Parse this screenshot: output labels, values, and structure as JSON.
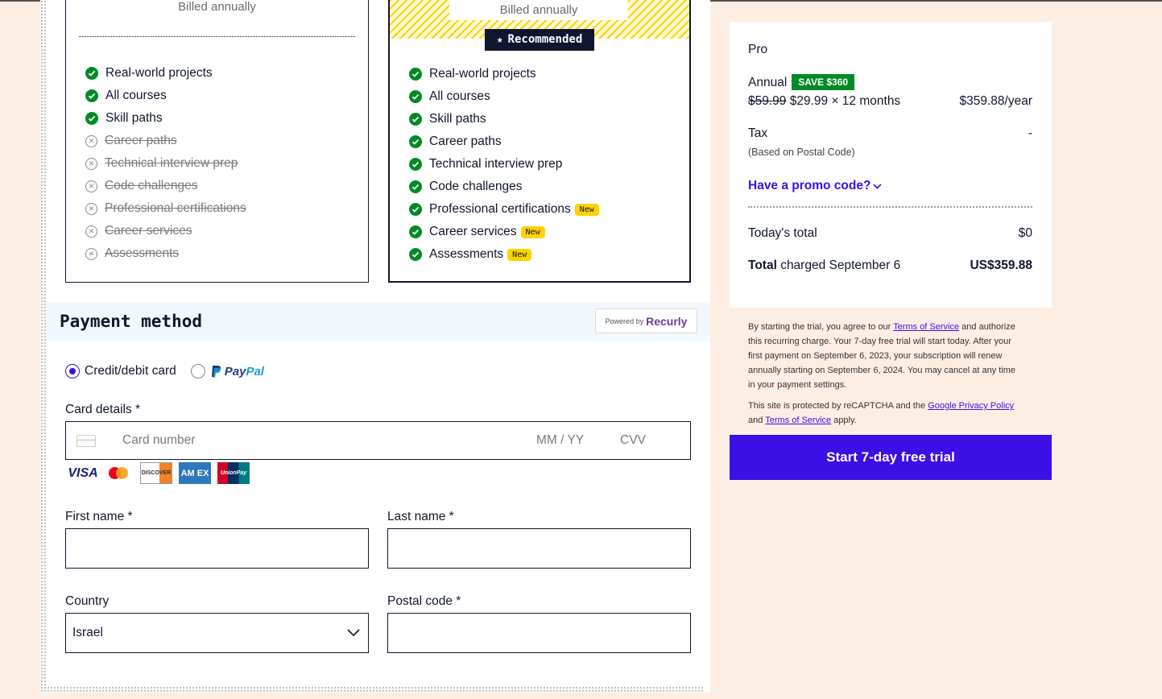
{
  "plans": {
    "basic": {
      "billing": "Billed annually",
      "features": [
        {
          "label": "Real-world projects",
          "included": true
        },
        {
          "label": "All courses",
          "included": true
        },
        {
          "label": "Skill paths",
          "included": true
        },
        {
          "label": "Career paths",
          "included": false
        },
        {
          "label": "Technical interview prep",
          "included": false
        },
        {
          "label": "Code challenges",
          "included": false
        },
        {
          "label": "Professional certifications",
          "included": false
        },
        {
          "label": "Career services",
          "included": false
        },
        {
          "label": "Assessments",
          "included": false
        }
      ]
    },
    "pro": {
      "billing": "Billed annually",
      "badge": "Recommended",
      "new_label": "New",
      "features": [
        {
          "label": "Real-world projects",
          "included": true
        },
        {
          "label": "All courses",
          "included": true
        },
        {
          "label": "Skill paths",
          "included": true
        },
        {
          "label": "Career paths",
          "included": true
        },
        {
          "label": "Technical interview prep",
          "included": true
        },
        {
          "label": "Code challenges",
          "included": true
        },
        {
          "label": "Professional certifications",
          "included": true,
          "new": true
        },
        {
          "label": "Career services",
          "included": true,
          "new": true
        },
        {
          "label": "Assessments",
          "included": true,
          "new": true
        }
      ]
    }
  },
  "payment": {
    "title": "Payment method",
    "powered_by": "Powered by",
    "provider": "Recurly",
    "options": {
      "card": "Credit/debit card",
      "paypal_a": "Pay",
      "paypal_b": "Pal"
    },
    "selected": "card",
    "card_details_label": "Card details *",
    "card_number_placeholder": "Card number",
    "expiry_placeholder": "MM / YY",
    "cvv_placeholder": "CVV",
    "brands": {
      "visa": "VISA",
      "discover": "DISCOVER",
      "amex": "AM EX",
      "unionpay": "UnionPay"
    },
    "first_name_label": "First name *",
    "last_name_label": "Last name *",
    "country_label": "Country",
    "country_value": "Israel",
    "postal_label": "Postal code *"
  },
  "summary": {
    "plan_name": "Pro",
    "billing_cycle": "Annual",
    "save_badge": "SAVE $360",
    "old_price": "$59.99",
    "price_detail": "$29.99 × 12 months",
    "yearly_total": "$359.88/year",
    "tax_label": "Tax",
    "tax_value": "-",
    "tax_note": "(Based on Postal Code)",
    "promo_link": "Have a promo code?",
    "today_label": "Today's total",
    "today_value": "$0",
    "total_bold": "Total",
    "total_label": "charged September 6",
    "total_value": "US$359.88"
  },
  "legal": {
    "p1_a": "By starting the trial, you agree to our ",
    "p1_link": "Terms of Service",
    "p1_b": " and authorize this recurring charge. Your 7-day free trial will start today. After your first payment on September 6, 2023, your subscription will renew annually starting on September 6, 2024. You may cancel at any time in your payment settings.",
    "p2_a": "This site is protected by reCAPTCHA and the ",
    "p2_link1": "Google Privacy Policy",
    "p2_b": " and ",
    "p2_link2": "Terms of Service",
    "p2_c": " apply."
  },
  "cta_label": "Start 7-day free trial",
  "colors": {
    "accent": "#3a10e5",
    "success": "#008a27",
    "highlight": "#ffd300",
    "navy": "#10162f",
    "page_bg": "#fdeee4"
  }
}
